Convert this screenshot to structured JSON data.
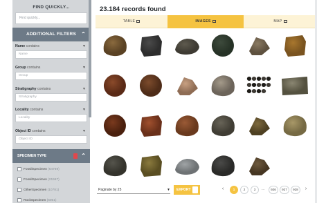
{
  "sidebar": {
    "title": "FIND QUICKLY...",
    "quick_placeholder": "Find quickly...",
    "additional_filters": "ADDITIONAL FILTERS",
    "filters": [
      {
        "field": "Name",
        "op": "contains",
        "placeholder": "Name"
      },
      {
        "field": "Group",
        "op": "contains",
        "placeholder": "Group"
      },
      {
        "field": "Stratigraphy",
        "op": "contains",
        "placeholder": "Stratigraphy"
      },
      {
        "field": "Locality",
        "op": "contains",
        "placeholder": "Locality"
      },
      {
        "field": "Object ID",
        "op": "contains",
        "placeholder": "Object ID"
      }
    ],
    "specimen_type": "SPECIMEN TYPE",
    "specimen_options": [
      {
        "label": "FossilSpecimen",
        "count": "(64769)"
      },
      {
        "label": "FossilSpecimen",
        "count": "(21557)"
      },
      {
        "label": "OtherSpecimen",
        "count": "(10781)"
      },
      {
        "label": "RockSpecimen",
        "count": "(6051)"
      }
    ]
  },
  "main": {
    "records_found": "23.184 records found",
    "tabs": [
      {
        "label": "TABLE",
        "icon": "table-icon"
      },
      {
        "label": "IMAGES",
        "icon": "image-icon"
      },
      {
        "label": "MAP",
        "icon": "map-icon"
      }
    ],
    "thumbnails": [
      {
        "name": "rock-specimen",
        "c1": "#8a6a3e",
        "c2": "#5a4224",
        "shape": "rock"
      },
      {
        "name": "rock-specimen",
        "c1": "#4a4a4a",
        "c2": "#2d2d2d",
        "shape": "block"
      },
      {
        "name": "rock-specimen",
        "c1": "#5e5a4e",
        "c2": "#3e3b33",
        "shape": "flat"
      },
      {
        "name": "rock-specimen",
        "c1": "#3d4a3c",
        "c2": "#263226",
        "shape": "round"
      },
      {
        "name": "rock-specimen",
        "c1": "#8a7a62",
        "c2": "#5e513f",
        "shape": "shard"
      },
      {
        "name": "rock-specimen",
        "c1": "#a8772e",
        "c2": "#7a5420",
        "shape": "block"
      },
      {
        "name": "rock-specimen",
        "c1": "#8a4a2a",
        "c2": "#5a2a16",
        "shape": "round"
      },
      {
        "name": "rock-specimen",
        "c1": "#7c4b2c",
        "c2": "#4e2c18",
        "shape": "round"
      },
      {
        "name": "rock-specimen",
        "c1": "#c8a082",
        "c2": "#8e6c54",
        "shape": "shard"
      },
      {
        "name": "rock-specimen",
        "c1": "#a49a8a",
        "c2": "#6c645a",
        "shape": "rock"
      },
      {
        "name": "rock-specimen",
        "c1": "#3e3a34",
        "c2": "#1e1c18",
        "shape": "pebbles"
      },
      {
        "name": "rock-specimen",
        "c1": "#8a8672",
        "c2": "#54513f",
        "shape": "slab"
      },
      {
        "name": "rock-specimen",
        "c1": "#7a3a1e",
        "c2": "#4a200e",
        "shape": "round"
      },
      {
        "name": "rock-specimen",
        "c1": "#a0502e",
        "c2": "#6a301a",
        "shape": "block"
      },
      {
        "name": "rock-specimen",
        "c1": "#9a5a36",
        "c2": "#6a3a1e",
        "shape": "rock"
      },
      {
        "name": "rock-specimen",
        "c1": "#686458",
        "c2": "#403d34",
        "shape": "rock"
      },
      {
        "name": "rock-specimen",
        "c1": "#7e6a3e",
        "c2": "#4e4022",
        "shape": "shard"
      },
      {
        "name": "rock-specimen",
        "c1": "#a89868",
        "c2": "#766a44",
        "shape": "rock"
      },
      {
        "name": "rock-specimen",
        "c1": "#55544c",
        "c2": "#34332c",
        "shape": "rock"
      },
      {
        "name": "rock-specimen",
        "c1": "#8a7a3e",
        "c2": "#5a4e22",
        "shape": "block"
      },
      {
        "name": "rock-specimen",
        "c1": "#a0a4a6",
        "c2": "#6e7274",
        "shape": "flat"
      },
      {
        "name": "rock-specimen",
        "c1": "#4a4a48",
        "c2": "#2a2a28",
        "shape": "rock"
      },
      {
        "name": "rock-specimen",
        "c1": "#6e5a3e",
        "c2": "#463622",
        "shape": "shard"
      },
      {
        "name": "rock-specimen",
        "c1": "#ffffff",
        "c2": "#ffffff",
        "shape": "empty"
      }
    ]
  },
  "footer": {
    "paginate_label": "Paginate by 25",
    "export_label": "EXPORT",
    "pages": [
      "1",
      "2",
      "3"
    ],
    "ellipsis": "...",
    "last_pages": [
      "926",
      "927",
      "928"
    ],
    "prev": "‹",
    "next": "›"
  },
  "colors": {
    "accent": "#f5c341",
    "sidebar_header": "#6d7a87",
    "sidebar_bg": "#d3d6d9",
    "tab_bg": "#fdf3d6"
  }
}
